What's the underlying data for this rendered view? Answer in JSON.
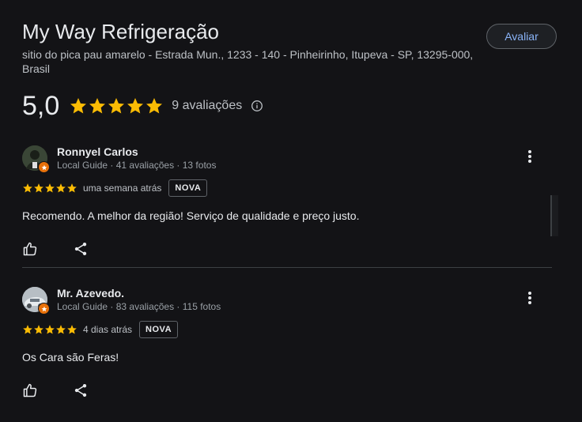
{
  "place": {
    "name": "My Way Refrigeração",
    "address": "sitio do pica pau amarelo - Estrada Mun., 1233 - 140 - Pinheirinho, Itupeva - SP, 13295-000, Brasil"
  },
  "actions": {
    "avaliar_label": "Avaliar"
  },
  "summary": {
    "rating": "5,0",
    "stars": 5,
    "count_label": "9 avaliações",
    "info_icon": "info-icon"
  },
  "colors": {
    "star": "#fbbc04",
    "accent": "#8ab4f8",
    "badge": "#e8710a"
  },
  "reviews": [
    {
      "author": "Ronnyel Carlos",
      "meta": "Local Guide · 41 avaliações · 13 fotos",
      "stars": 5,
      "time": "uma semana atrás",
      "badge": "NOVA",
      "text": "Recomendo. A melhor da região! Serviço de qualidade e preço justo.",
      "avatar_color": "#2f3a2a"
    },
    {
      "author": "Mr. Azevedo.",
      "meta": "Local Guide · 83 avaliações · 115 fotos",
      "stars": 5,
      "time": "4 dias atrás",
      "badge": "NOVA",
      "text": "Os Cara são Feras!",
      "avatar_color": "#9aa3ab"
    }
  ]
}
